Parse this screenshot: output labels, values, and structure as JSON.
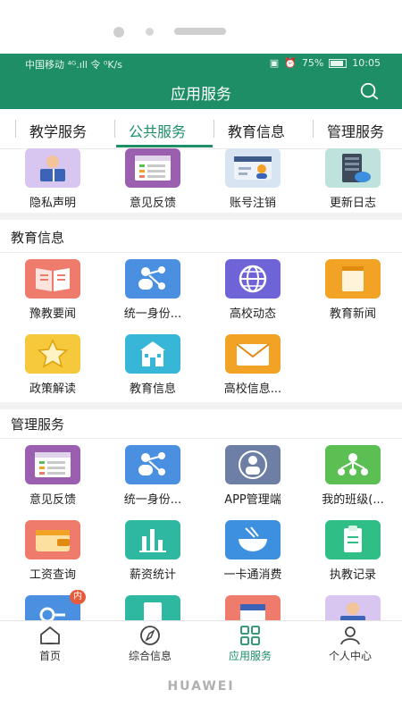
{
  "status_bar": {
    "carrier": "中国移动 ⁴ᴳ.ıll 令 ⁰K/s",
    "battery": "75%",
    "time": "10:05"
  },
  "app_bar": {
    "title": "应用服务",
    "search_icon": "search-icon"
  },
  "tabs": [
    {
      "label": "教学服务"
    },
    {
      "label": "公共服务",
      "active": true
    },
    {
      "label": "教育信息"
    },
    {
      "label": "管理服务"
    }
  ],
  "public_services": {
    "items": [
      {
        "label": "隐私声明",
        "icon": "reading-person-icon",
        "color": "#d9c6f0"
      },
      {
        "label": "意见反馈",
        "icon": "feedback-list-icon",
        "color": "#9b5fb0"
      },
      {
        "label": "账号注销",
        "icon": "account-card-icon",
        "color": "#d9e4f2"
      },
      {
        "label": "更新日志",
        "icon": "server-cloud-icon",
        "color": "#bfe3dc"
      }
    ]
  },
  "education_info": {
    "title": "教育信息",
    "items": [
      {
        "label": "豫教要闻",
        "icon": "open-book-icon",
        "color": "#ef7b6d"
      },
      {
        "label": "统一身份...",
        "icon": "user-share-icon",
        "color": "#4a8fe0"
      },
      {
        "label": "高校动态",
        "icon": "globe-icon",
        "color": "#6f63d8"
      },
      {
        "label": "教育新闻",
        "icon": "notepad-icon",
        "color": "#f2a225"
      },
      {
        "label": "政策解读",
        "icon": "star-icon",
        "color": "#f5c93b"
      },
      {
        "label": "教育信息",
        "icon": "school-building-icon",
        "color": "#38b6d8"
      },
      {
        "label": "高校信息...",
        "icon": "envelope-icon",
        "color": "#f2a225"
      }
    ]
  },
  "management": {
    "title": "管理服务",
    "items": [
      {
        "label": "意见反馈",
        "icon": "feedback-list-icon",
        "color": "#9b5fb0"
      },
      {
        "label": "统一身份...",
        "icon": "user-share-icon",
        "color": "#4a8fe0"
      },
      {
        "label": "APP管理端",
        "icon": "manager-admin-icon",
        "color": "#6e7fa6"
      },
      {
        "label": "我的班级(...",
        "icon": "class-network-icon",
        "color": "#5bbf54"
      },
      {
        "label": "工资查询",
        "icon": "wallet-icon",
        "color": "#ef7b6d"
      },
      {
        "label": "薪资统计",
        "icon": "bar-stats-icon",
        "color": "#2fb8a1"
      },
      {
        "label": "一卡通消费",
        "icon": "bowl-icon",
        "color": "#3d8fe0"
      },
      {
        "label": "执教记录",
        "icon": "clipboard-icon",
        "color": "#2fbf86"
      },
      {
        "label": "",
        "icon": "key-icon",
        "color": "#4a8fe0",
        "badge": "内"
      },
      {
        "label": "",
        "icon": "document-icon",
        "color": "#2fb8a1"
      },
      {
        "label": "",
        "icon": "calendar-icon",
        "color": "#ef7b6d"
      },
      {
        "label": "",
        "icon": "reading-person-icon",
        "color": "#d9c6f0"
      }
    ]
  },
  "bottom_nav": [
    {
      "label": "首页",
      "icon": "home-icon"
    },
    {
      "label": "综合信息",
      "icon": "compass-icon"
    },
    {
      "label": "应用服务",
      "icon": "grid-icon",
      "active": true
    },
    {
      "label": "个人中心",
      "icon": "person-icon"
    }
  ],
  "device_brand": "HUAWEI"
}
